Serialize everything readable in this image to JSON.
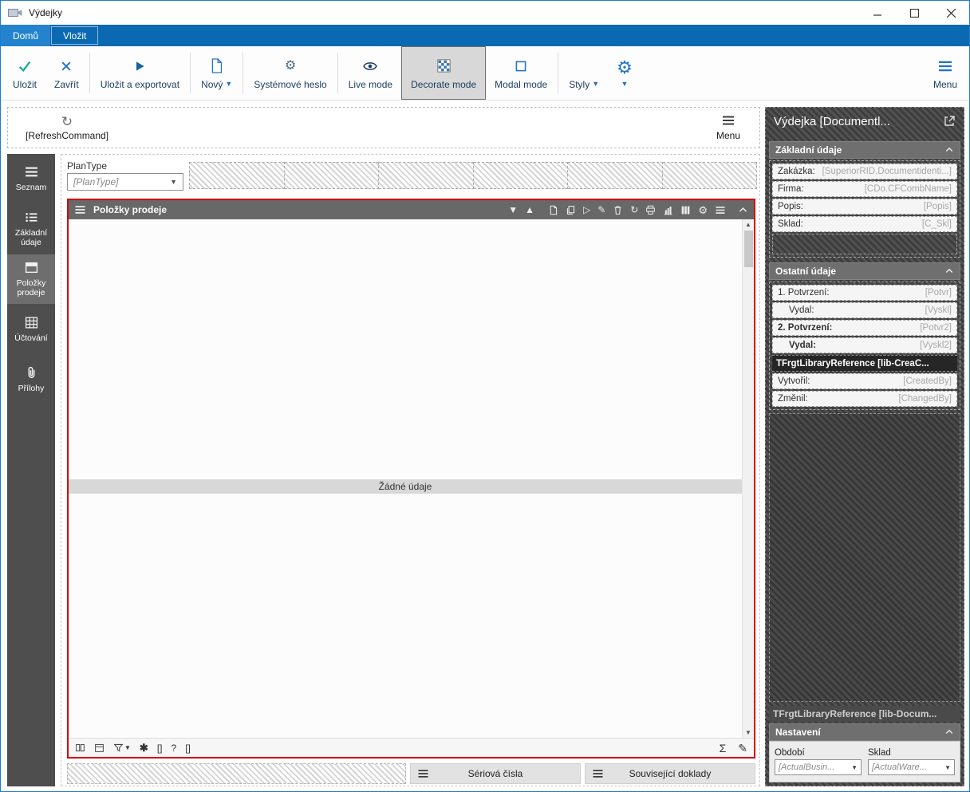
{
  "window": {
    "title": "Výdejky"
  },
  "ribbon": {
    "tabs": [
      {
        "label": "Domů"
      },
      {
        "label": "Vložit"
      }
    ]
  },
  "toolbar": {
    "save": "Uložit",
    "close": "Zavřít",
    "save_export": "Uložit a exportovat",
    "new": "Nový",
    "system_password": "Systémové heslo",
    "live_mode": "Live mode",
    "decorate_mode": "Decorate mode",
    "modal_mode": "Modal mode",
    "styles": "Styly",
    "menu": "Menu"
  },
  "subtoolbar": {
    "refresh": "[RefreshCommand]",
    "menu": "Menu"
  },
  "sidebar": {
    "items": [
      {
        "label": "Seznam",
        "icon": "menu-icon"
      },
      {
        "label": "Základní údaje",
        "icon": "list-icon"
      },
      {
        "label": "Položky prodeje",
        "icon": "panel-icon"
      },
      {
        "label": "Účtování",
        "icon": "table-icon"
      },
      {
        "label": "Přílohy",
        "icon": "paperclip-icon"
      }
    ]
  },
  "main": {
    "plantype_label": "PlanType",
    "plantype_value": "[PlanType]",
    "panel_title": "Položky prodeje",
    "empty_text": "Žádné údaje",
    "serial_numbers": "Sériová čísla",
    "related_documents": "Související doklady"
  },
  "inspector": {
    "title": "Výdejka [Documentl...",
    "basic": {
      "title": "Základní údaje",
      "fields": [
        {
          "label": "Zakázka:",
          "value": "[SuperiorRID.Documentidenti...]"
        },
        {
          "label": "Firma:",
          "value": "[CDo.CFCombName]"
        },
        {
          "label": "Popis:",
          "value": "[Popis]"
        },
        {
          "label": "Sklad:",
          "value": "[C_Skl]"
        }
      ]
    },
    "other": {
      "title": "Ostatní údaje",
      "fields": [
        {
          "label": "1. Potvrzení:",
          "value": "[Potvr]"
        },
        {
          "label": "Vydal:",
          "value": "[Vyskl]"
        },
        {
          "label": "2. Potvrzení:",
          "value": "[Potvr2]"
        },
        {
          "label": "Vydal:",
          "value": "[Vyskl2]"
        }
      ],
      "library_ref": "TFrgtLibraryReference [lib-CreaC...",
      "audit_fields": [
        {
          "label": "Vytvořil:",
          "value": "[CreatedBy]"
        },
        {
          "label": "Změnil:",
          "value": "[ChangedBy]"
        }
      ]
    },
    "library_ref2": "TFrgtLibraryReference [lib-Docum...",
    "settings": {
      "title": "Nastavení",
      "period_label": "Období",
      "period_value": "[ActualBusin...",
      "warehouse_label": "Sklad",
      "warehouse_value": "[ActualWare..."
    },
    "colors": {
      "accent_blue": "#0b69b2",
      "panel_border_red": "#d40000"
    }
  }
}
